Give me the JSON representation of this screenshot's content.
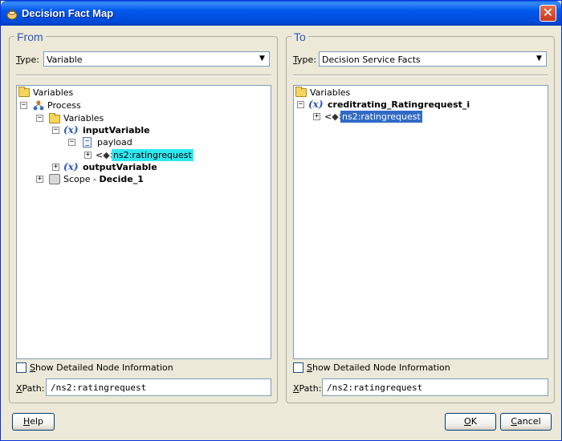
{
  "window": {
    "title": "Decision Fact Map",
    "close_glyph": "✕"
  },
  "from": {
    "title": "From",
    "type_label_first": "T",
    "type_label_rest": "ype:",
    "type_value": "Variable",
    "tree": {
      "variables_root": "Variables",
      "process": "Process",
      "variables": "Variables",
      "input_variable": "inputVariable",
      "payload": "payload",
      "input_element": "ns2:ratingrequest",
      "output_variable": "outputVariable",
      "scope_prefix": "Scope - ",
      "scope_name": "Decide_1"
    },
    "show_detail_first": "S",
    "show_detail_rest": "how Detailed Node Information",
    "xpath_label_first": "X",
    "xpath_label_rest": "Path:",
    "xpath_value": "/ns2:ratingrequest"
  },
  "to": {
    "title": "To",
    "type_label_first": "T",
    "type_label_rest": "ype:",
    "type_value": "Decision Service Facts",
    "tree": {
      "variables_root": "Variables",
      "variable": "creditrating_Ratingrequest_i",
      "element": "ns2:ratingrequest"
    },
    "show_detail_first": "S",
    "show_detail_rest": "how Detailed Node Information",
    "xpath_label_first": "X",
    "xpath_label_rest": "Path:",
    "xpath_value": "/ns2:ratingrequest"
  },
  "buttons": {
    "help_first": "H",
    "help_rest": "elp",
    "ok_first": "O",
    "ok_rest": "K",
    "cancel_first": "C",
    "cancel_rest": "ancel"
  },
  "icons": {
    "expand": "+",
    "collapse": "−",
    "dropdown": "▼",
    "variable": "(x)",
    "element": "<◆>"
  },
  "colors": {
    "selection_cyan": "#2EE8F0",
    "selection_blue": "#316AC5",
    "group_title": "#2C57B4"
  }
}
